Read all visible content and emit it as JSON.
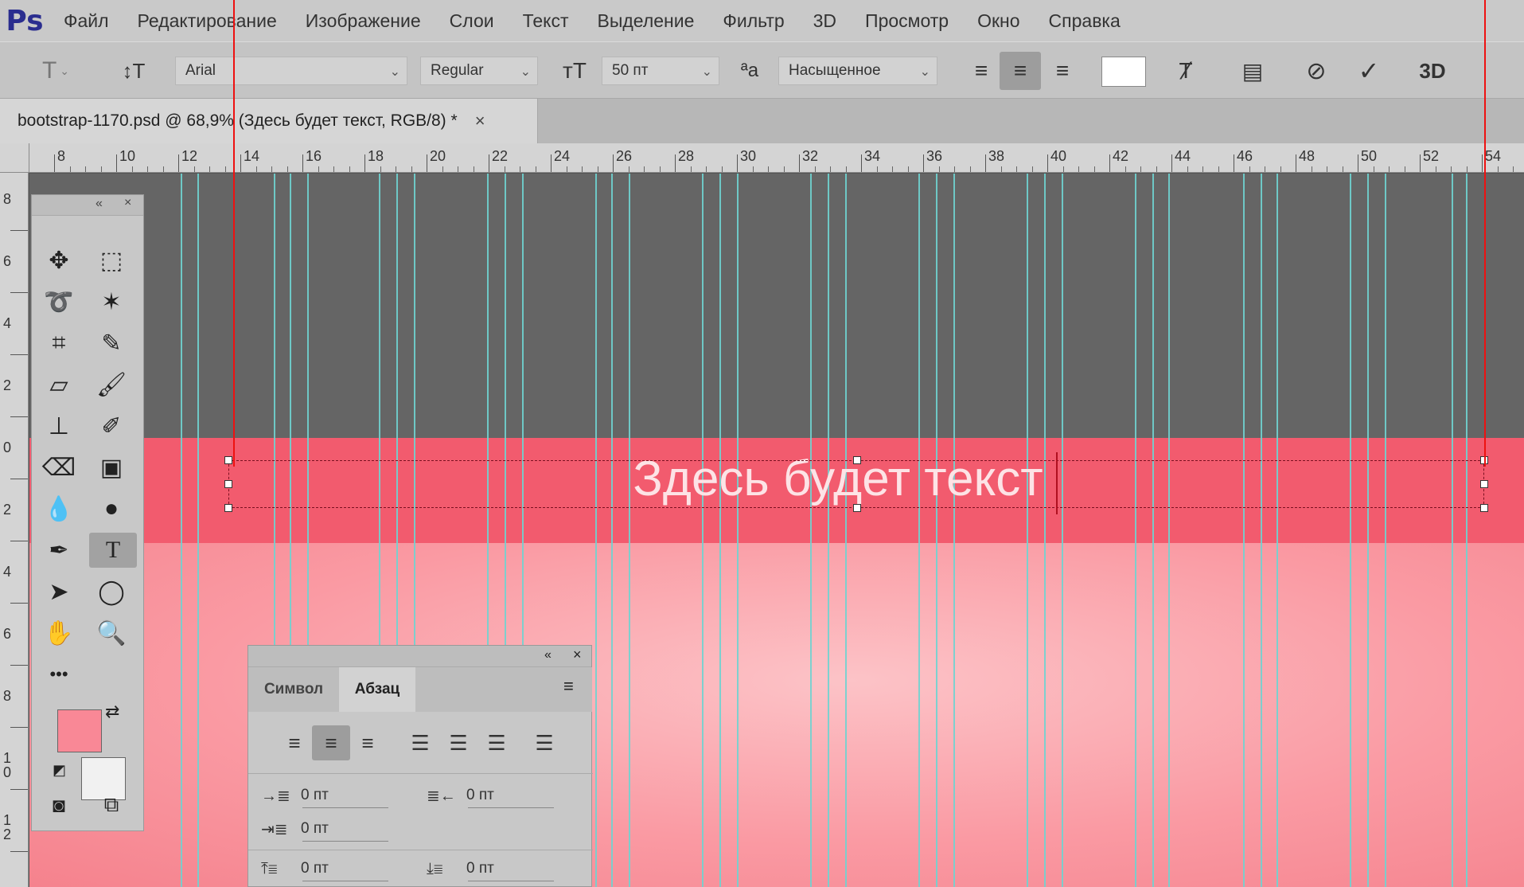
{
  "menubar": {
    "logo": "Ps",
    "items": [
      "Файл",
      "Редактирование",
      "Изображение",
      "Слои",
      "Текст",
      "Выделение",
      "Фильтр",
      "3D",
      "Просмотр",
      "Окно",
      "Справка"
    ]
  },
  "options": {
    "font_family": "Arial",
    "font_style": "Regular",
    "font_size": "50 пт",
    "antialias": "Насыщенное",
    "threed_label": "3D",
    "text_color": "#ffffff"
  },
  "document": {
    "tab_title": "bootstrap-1170.psd @ 68,9% (Здесь будет текст, RGB/8) *",
    "close": "×"
  },
  "rulers": {
    "horizontal": [
      "8",
      "10",
      "12",
      "14",
      "16",
      "18",
      "20",
      "22",
      "24",
      "26",
      "28",
      "30",
      "32",
      "34",
      "36",
      "38",
      "40",
      "42",
      "44",
      "46",
      "48",
      "50",
      "52",
      "54"
    ],
    "vertical": [
      "8",
      "6",
      "4",
      "2",
      "0",
      "2",
      "4",
      "6",
      "8",
      "10",
      "12"
    ]
  },
  "canvas": {
    "headline": "Здесь будет текст",
    "dark_color": "#656565",
    "band_color": "#f25b6e"
  },
  "toolbox": {
    "more": "•••",
    "foreground_color": "#f98896",
    "background_color": "#f1f1f1"
  },
  "paragraph_panel": {
    "tab_symbol": "Символ",
    "tab_paragraph": "Абзац",
    "indent_left": "0 пт",
    "indent_right": "0 пт",
    "indent_first": "0 пт",
    "space_before": "0 пт",
    "space_after": "0 пт"
  }
}
